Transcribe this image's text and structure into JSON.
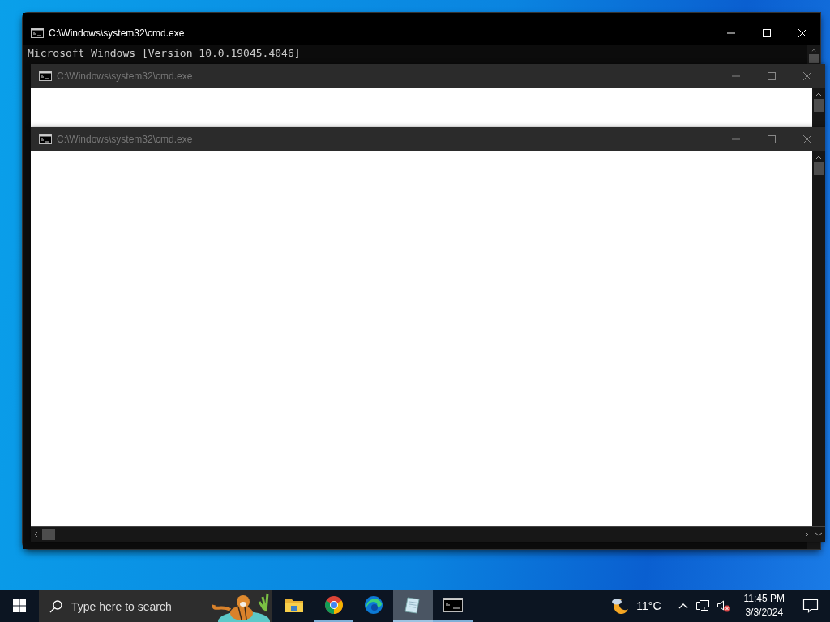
{
  "windows": [
    {
      "title": "C:\\Windows\\system32\\cmd.exe",
      "active": true,
      "lines": [
        "Microsoft Windows [Version 10.0.19045.4046]"
      ]
    },
    {
      "title": "C:\\Windows\\system32\\cmd.exe",
      "active": false
    },
    {
      "title": "C:\\Windows\\system32\\cmd.exe",
      "active": false
    }
  ],
  "taskbar": {
    "search": {
      "placeholder": "Type here to search"
    },
    "apps": [
      {
        "kind": "folder",
        "running": false,
        "selected": false
      },
      {
        "kind": "chrome",
        "running": true,
        "selected": false
      },
      {
        "kind": "edge",
        "running": false,
        "selected": false
      },
      {
        "kind": "notepad",
        "running": true,
        "selected": true
      },
      {
        "kind": "console",
        "running": true,
        "selected": false
      }
    ],
    "weather": {
      "temperature": "11°C"
    },
    "clock": {
      "time": "11:45 PM",
      "date": "3/3/2024"
    }
  }
}
